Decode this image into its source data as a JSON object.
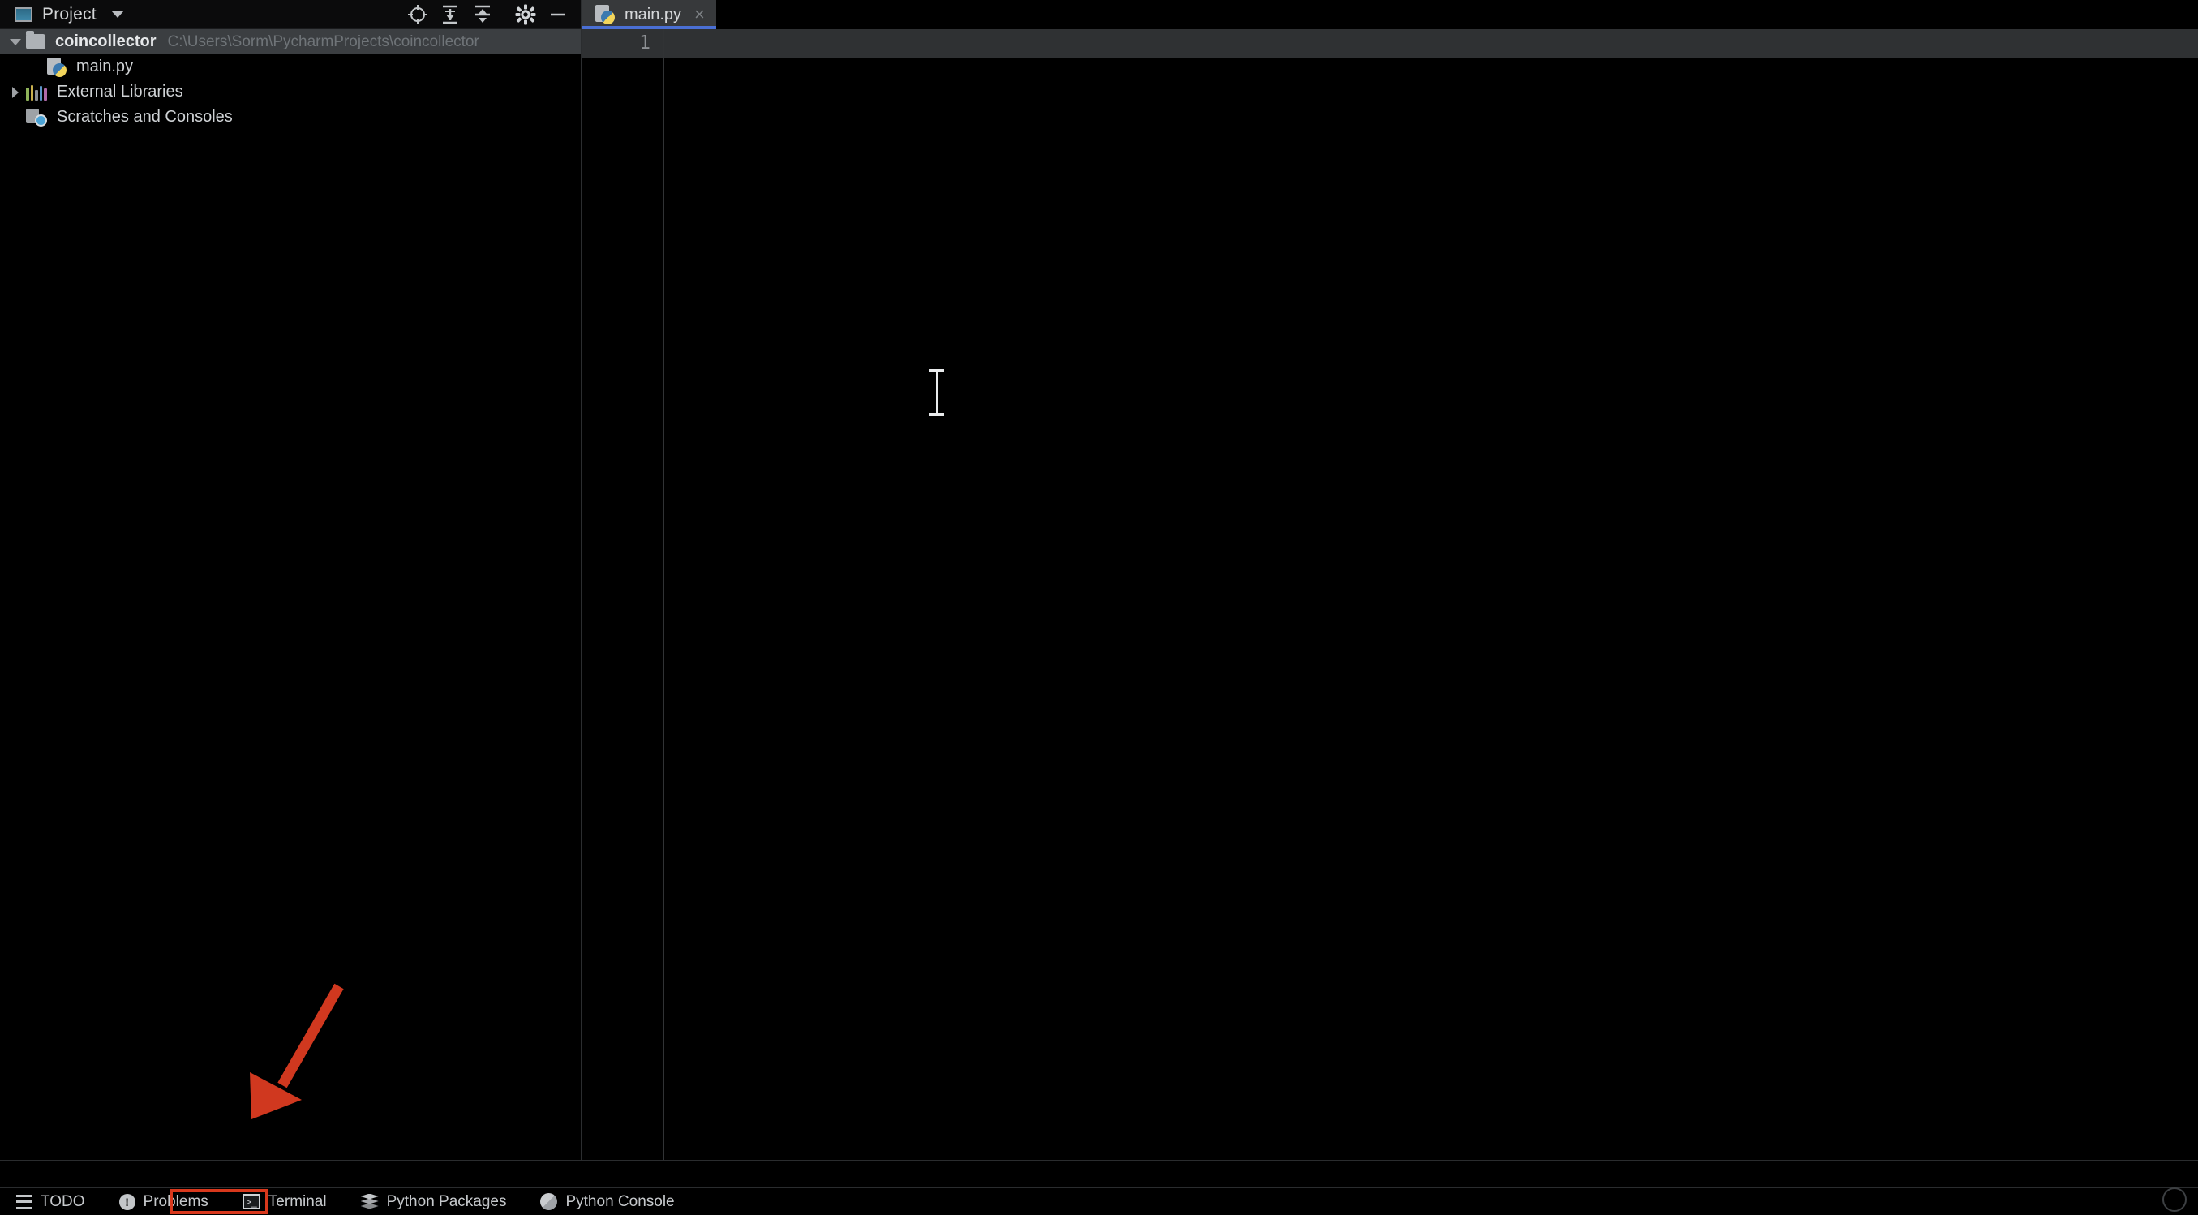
{
  "project_panel": {
    "title": "Project",
    "icon": "project-panel-icon",
    "dropdown_icon": "chevron-down-icon",
    "actions": [
      {
        "name": "select-opened-file-icon",
        "glyph": "crosshair"
      },
      {
        "name": "expand-all-icon",
        "glyph": "expand-all"
      },
      {
        "name": "collapse-all-icon",
        "glyph": "collapse-all"
      },
      {
        "name": "settings-gear-icon",
        "glyph": "gear"
      },
      {
        "name": "hide-panel-icon",
        "glyph": "minimize"
      }
    ],
    "tree": [
      {
        "label": "coincollector",
        "path": "C:\\Users\\Sorm\\PycharmProjects\\coincollector",
        "icon": "folder-icon",
        "twisty": "expanded",
        "selected": true
      },
      {
        "label": "main.py",
        "path": "",
        "icon": "python-file-icon",
        "twisty": "none",
        "selected": false
      },
      {
        "label": "External Libraries",
        "path": "",
        "icon": "external-libraries-icon",
        "twisty": "collapsed",
        "selected": false
      },
      {
        "label": "Scratches and Consoles",
        "path": "",
        "icon": "scratches-icon",
        "twisty": "none",
        "selected": false
      }
    ]
  },
  "editor": {
    "tabs": [
      {
        "label": "main.py",
        "icon": "python-file-icon",
        "close_glyph": "×",
        "active": true
      }
    ],
    "line_numbers": [
      "1"
    ],
    "content": "",
    "caret_line": 1
  },
  "bottom_bar": {
    "items": [
      {
        "label": "TODO",
        "icon": "todo-icon",
        "highlighted": false
      },
      {
        "label": "Problems",
        "icon": "problems-icon",
        "highlighted": false
      },
      {
        "label": "Terminal",
        "icon": "terminal-icon",
        "highlighted": true
      },
      {
        "label": "Python Packages",
        "icon": "python-packages-icon",
        "highlighted": false
      },
      {
        "label": "Python Console",
        "icon": "python-console-icon",
        "highlighted": false
      }
    ]
  },
  "annotations": {
    "arrow": {
      "name": "red-arrow-pointer",
      "color": "#d0381f",
      "points_to": "Terminal"
    },
    "box": {
      "name": "terminal-highlight-box",
      "color": "#d8381c",
      "around": "Terminal"
    }
  },
  "colors": {
    "background": "#000000",
    "panel_header": "#0b0b0c",
    "tree_selection": "#3b3e41",
    "tab_active": "#37393b",
    "tab_underline": "#4a6fd4",
    "caret_line": "#2f3133",
    "annotation_red": "#d8381c",
    "text_primary": "#cfd2d5",
    "text_muted": "#6f7478"
  }
}
